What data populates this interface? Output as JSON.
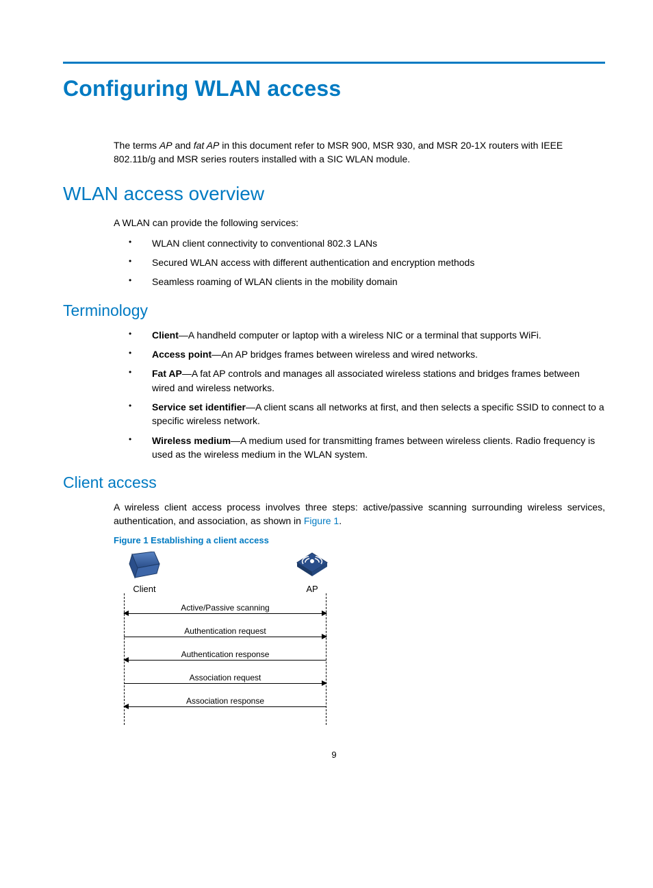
{
  "title": "Configuring WLAN access",
  "intro_parts": {
    "p1": "The terms ",
    "em1": "AP",
    "p2": " and ",
    "em2": "fat AP",
    "p3": " in this document refer to MSR 900, MSR 930, and MSR 20-1X routers with IEEE 802.11b/g and MSR series routers installed with a SIC WLAN module."
  },
  "s1": {
    "heading": "WLAN access overview",
    "lead": "A WLAN can provide the following services:",
    "items": [
      "WLAN client connectivity to conventional 802.3 LANs",
      "Secured WLAN access with different authentication and encryption methods",
      "Seamless roaming of WLAN clients in the mobility domain"
    ]
  },
  "s2": {
    "heading": "Terminology",
    "items": [
      {
        "term": "Client",
        "desc": "—A handheld computer or laptop with a wireless NIC or a terminal that supports WiFi."
      },
      {
        "term": "Access point",
        "desc": "—An AP bridges frames between wireless and wired networks."
      },
      {
        "term": "Fat AP",
        "desc": "—A fat AP controls and manages all associated wireless stations and bridges frames between wired and wireless networks."
      },
      {
        "term": "Service set identifier",
        "desc": "—A client scans all networks at first, and then selects a specific SSID to connect to a specific wireless network."
      },
      {
        "term": "Wireless medium",
        "desc": "—A medium used for transmitting frames between wireless clients. Radio frequency is used as the wireless medium in the WLAN system."
      }
    ]
  },
  "s3": {
    "heading": "Client access",
    "para_pre": "A wireless client access process involves three steps: active/passive scanning surrounding wireless services, authentication, and association, as shown in ",
    "figref": "Figure 1",
    "para_post": ".",
    "figcap": "Figure 1 Establishing a client access",
    "fig": {
      "left_label": "Client",
      "right_label": "AP",
      "messages": [
        {
          "text": "Active/Passive scanning",
          "dir": "both"
        },
        {
          "text": "Authentication request",
          "dir": "right"
        },
        {
          "text": "Authentication response",
          "dir": "left"
        },
        {
          "text": "Association request",
          "dir": "right"
        },
        {
          "text": "Association response",
          "dir": "left"
        }
      ]
    }
  },
  "page_number": "9"
}
